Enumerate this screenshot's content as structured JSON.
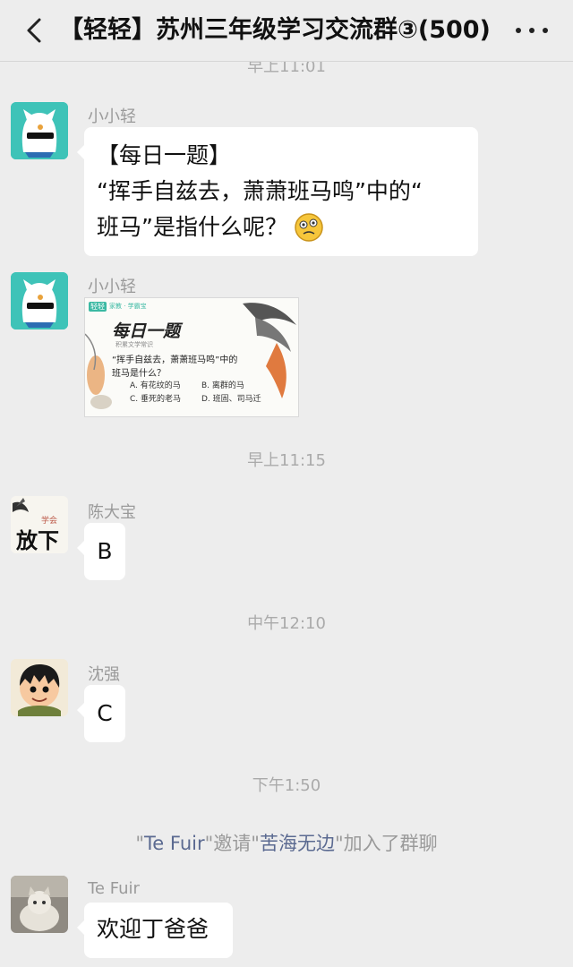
{
  "header": {
    "title": "【轻轻】苏州三年级学习交流群③(500)"
  },
  "messages": {
    "ts0": "早上11:01",
    "m1": {
      "sender": "小小轻",
      "line1": "【每日一题】",
      "line2": "“挥手自兹去，萧萧班马鸣”中的“",
      "line3": "班马”是指什么呢？"
    },
    "m2": {
      "sender": "小小轻",
      "card": {
        "logo_a": "轻轻",
        "logo_b": "家教 · 学霸宝",
        "title": "每日一题",
        "subtitle": "积累文学常识",
        "q1": "“挥手自兹去，萧萧班马鸣”中的",
        "q2": "班马是什么？",
        "optA": "A. 有花纹的马",
        "optB": "B. 离群的马",
        "optC": "C. 垂死的老马",
        "optD": "D. 班固、司马迁"
      }
    },
    "ts1": "早上11:15",
    "m3": {
      "sender": "陈大宝",
      "text": "B",
      "avatar_text_a": "放下",
      "avatar_text_b": "学会"
    },
    "ts2": "中午12:10",
    "m4": {
      "sender": "沈强",
      "text": "C"
    },
    "ts3": "下午1:50",
    "sys": {
      "q1": "\"",
      "inviter": "Te  Fuir",
      "q2": "\"邀请\"",
      "invitee": "苦海无边",
      "q3": "\"加入了群聊"
    },
    "m5": {
      "sender": "Te  Fuir",
      "text": "欢迎丁爸爸"
    }
  },
  "colors": {
    "background": "#ededed",
    "bubble": "#ffffff",
    "timestamp": "#aaaaaa",
    "name_link": "#5b6a91"
  }
}
